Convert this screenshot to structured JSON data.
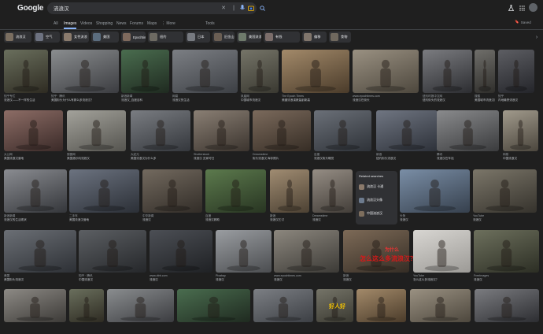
{
  "header": {
    "logo": "Google",
    "query": "流浪汉",
    "right_label": "Saved"
  },
  "tabs": [
    {
      "label": "All",
      "active": false
    },
    {
      "label": "Images",
      "active": true
    },
    {
      "label": "Videos",
      "active": false
    },
    {
      "label": "Shopping",
      "active": false
    },
    {
      "label": "News",
      "active": false
    },
    {
      "label": "Forums",
      "active": false
    },
    {
      "label": "Maps",
      "active": false
    },
    {
      "label": "⋮ More",
      "active": false
    },
    {
      "label": "Tools",
      "active": false
    }
  ],
  "chips": [
    "流浪汉",
    "空气",
    "女性流浪",
    "美国",
    "Epochtimes",
    "纽约",
    "日本",
    "旧金山",
    "美国流浪",
    "有钱",
    "偏移",
    "食物"
  ],
  "images": [
    {
      "src": "知乎专栏",
      "title": "流浪汉——不一样的生活",
      "c1": "#6a6f5d",
      "c2": "#2e2b22"
    },
    {
      "src": "知乎 · 腾讯",
      "title": "美国街头为什么有那么多流浪汉？",
      "c1": "#8a8d8f",
      "c2": "#3b3c40"
    },
    {
      "src": "新浪新闻",
      "title": "流浪汉_百度百科",
      "c1": "#4a6d4f",
      "c2": "#1f2a20"
    },
    {
      "src": "网易",
      "title": "流浪汉的生活",
      "c1": "#7c7f84",
      "c2": "#3c3f44"
    },
    {
      "src": "凤凰网",
      "title": "中国城市流浪汉",
      "c1": "#757468",
      "c2": "#3a3931"
    },
    {
      "src": "The Epoch Times",
      "title": "美國流浪漢數量創新高",
      "c1": "#a38a6a",
      "c2": "#4a3b2a"
    },
    {
      "src": "www.epochtimes.com",
      "title": "流浪汉在街头",
      "c1": "#9a9182",
      "c2": "#4d473d"
    },
    {
      "src": "纽约时报中文网",
      "title": "纽约街头的流浪汉",
      "c1": "#7b7c80",
      "c2": "#2c2d31"
    },
    {
      "src": "搜狐",
      "title": "美国城市流浪汉问题",
      "c1": "#6f6e6a",
      "c2": "#2f2e2b"
    },
    {
      "src": "知乎",
      "title": "内地最惨流浪汉",
      "c1": "#5d5e63",
      "c2": "#24252a"
    },
    {
      "src": "大公网",
      "title": "美国流浪汉营地",
      "c1": "#8d6d66",
      "c2": "#3a2a28"
    },
    {
      "src": "搜狐网",
      "title": "美国洛杉矶流浪汉",
      "c1": "#a3a29b",
      "c2": "#55544f"
    },
    {
      "src": "大纪元",
      "title": "美国流浪汉为什么多",
      "c1": "#7a7d82",
      "c2": "#34373c"
    },
    {
      "src": "Shutterstock",
      "title": "流浪汉 无家可归",
      "c1": "#8a7f74",
      "c2": "#3b342e"
    },
    {
      "src": "Dreamstime",
      "title": "街头流浪汉 库存照片",
      "c1": "#7b6a5c",
      "c2": "#362d25"
    },
    {
      "src": "百度",
      "title": "流浪汉街头睡觉",
      "c1": "#6b7078",
      "c2": "#2e3238"
    },
    {
      "src": "新浪",
      "title": "纽约街头流浪汉",
      "c1": "#707682",
      "c2": "#2d3139"
    },
    {
      "src": "腾讯",
      "title": "流浪汉在车站",
      "c1": "#8a8b8d",
      "c2": "#3a3b3d"
    },
    {
      "src": "网易",
      "title": "中国流浪汉",
      "c1": "#a19a8c",
      "c2": "#4b463d"
    },
    {
      "src": "新浪新闻",
      "title": "流浪汉的生活现状",
      "c1": "#8a8c91",
      "c2": "#34363a"
    },
    {
      "src": "二手车",
      "title": "美国流浪汉营地",
      "c1": "#6c7380",
      "c2": "#2b2f36"
    },
    {
      "src": "中华新闻",
      "title": "流浪汉",
      "c1": "#736a5f",
      "c2": "#312c27"
    },
    {
      "src": "百度",
      "title": "流浪汉救助",
      "c1": "#5c7a4d",
      "c2": "#283522"
    },
    {
      "src": "新浪",
      "title": "流浪汉乞讨",
      "c1": "#a08c72",
      "c2": "#4c4133"
    },
    {
      "src": "Dreamstime",
      "title": "流浪汉",
      "c1": "#958d84",
      "c2": "#433e39"
    },
    {
      "src": "头条",
      "title": "流浪汉",
      "c1": "#7a8ea6",
      "c2": "#36404d"
    },
    {
      "src": "YouTube",
      "title": "流浪汉",
      "c1": "#7b7669",
      "c2": "#35322c"
    },
    {
      "src": "美国",
      "title": "美国街头流浪汉",
      "c1": "#6b6f75",
      "c2": "#2d3035"
    },
    {
      "src": "知乎 · 腾讯",
      "title": "中国流浪汉",
      "c1": "#5c5f63",
      "c2": "#25272a"
    },
    {
      "src": "www.dtrb.com",
      "title": "流浪汉",
      "c1": "#4c4f55",
      "c2": "#1f2124"
    },
    {
      "src": "Pixabay",
      "title": "流浪汉",
      "c1": "#9a9da1",
      "c2": "#4b4d50"
    },
    {
      "src": "www.epochtimes.com",
      "title": "流浪汉",
      "c1": "#8c877e",
      "c2": "#3c3a36"
    },
    {
      "src": "新浪",
      "title": "流浪汉",
      "c1": "#7d6a57",
      "c2": "#352d25"
    },
    {
      "src": "YouTube",
      "title": "怎么这么多流浪汉？",
      "c1": "#d8d6d2",
      "c2": "#9c9a96"
    },
    {
      "src": "FreeImages",
      "title": "流浪汉",
      "c1": "#6d705d",
      "c2": "#2c2e24"
    },
    {
      "src": "知乎",
      "title": "流浪汉",
      "c1": "#8d8a85",
      "c2": "#3c3a37"
    }
  ],
  "related": {
    "heading": "Related searches",
    "items": [
      "流浪汉 卡通",
      "流浪汉头像",
      "中国流浪汉"
    ]
  },
  "overlays": {
    "banner_red": "为什么",
    "banner_main": "怎么这么多流浪汉？",
    "fire": "好人好"
  }
}
